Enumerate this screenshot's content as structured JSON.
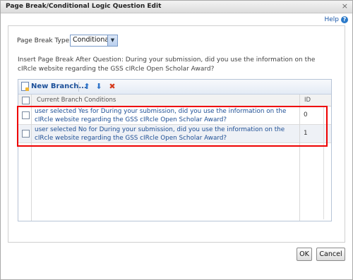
{
  "window": {
    "title": "Page Break/Conditional Logic Question Edit",
    "close_glyph": "×",
    "help_label": "Help",
    "help_glyph": "?"
  },
  "form": {
    "page_break_type_label": "Page Break Type:",
    "page_break_type_value": "Conditional",
    "insert_text": "Insert Page Break After Question: During your submission, did you use the information on the cIRcle website regarding the GSS cIRcle Open Scholar Award?"
  },
  "toolbar": {
    "new_branch_label": "New Branch...",
    "icons": [
      "new-branch-icon",
      "move-up-icon",
      "move-down-icon",
      "delete-icon"
    ]
  },
  "grid": {
    "headers": {
      "conditions": "Current Branch Conditions",
      "id": "ID"
    },
    "rows": [
      {
        "condition": "user selected Yes for During your submission, did you use the information on the cIRcle website regarding the GSS cIRcle Open Scholar Award?",
        "id": "0"
      },
      {
        "condition": "user selected No for During your submission, did you use the information on the cIRcle website regarding the GSS cIRcle Open Scholar Award?",
        "id": "1"
      }
    ]
  },
  "footer": {
    "ok_label": "OK",
    "cancel_label": "Cancel"
  },
  "colors": {
    "highlight": "#e00000",
    "link": "#1b4f99"
  }
}
